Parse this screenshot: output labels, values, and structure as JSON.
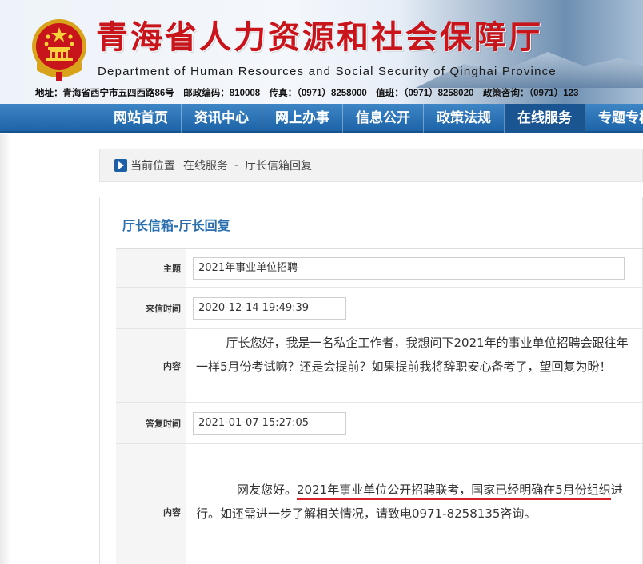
{
  "header": {
    "title_cn": "青海省人力资源和社会保障厅",
    "title_en": "Department of Human Resources and Social Security of Qinghai Province",
    "address_line": "地址：青海省西宁市五四西路86号　邮政编码：810008　传真：（0971）8258000　值班：（0971）8258020　政策咨询：（0971）123"
  },
  "nav": {
    "items": [
      "网站首页",
      "资讯中心",
      "网上办事",
      "信息公开",
      "政策法规",
      "在线服务",
      "专题专栏"
    ],
    "active_index": 5
  },
  "breadcrumb": {
    "label": "当前位置",
    "section": "在线服务",
    "separator": "-",
    "page": "厅长信箱回复"
  },
  "panel": {
    "title": "厅长信箱-厅长回复",
    "rows": {
      "subject": {
        "label": "主题",
        "value": "2021年事业单位招聘"
      },
      "sent_time": {
        "label": "来信时间",
        "value": "2020-12-14 19:49:39"
      },
      "content": {
        "label": "内容",
        "value": "厅长您好，我是一名私企工作者，我想问下2021年的事业单位招聘会跟往年一样5月份考试嘛？还是会提前？如果提前我将辞职安心备考了，望回复为盼！"
      },
      "reply_time": {
        "label": "答复时间",
        "value": "2021-01-07 15:27:05"
      },
      "reply": {
        "label": "内容",
        "prefix": "网友您好。",
        "highlight": "2021年事业单位公开招聘联考，国家已经明确在5月份组织",
        "suffix": "进行。如还需进一步了解相关情况，请致电0971-8258135咨询。"
      }
    }
  },
  "colors": {
    "title_red": "#c8141b",
    "nav_blue": "#1d63a8",
    "panel_title_blue": "#2a6fb0",
    "underline_red": "#d61f26"
  }
}
